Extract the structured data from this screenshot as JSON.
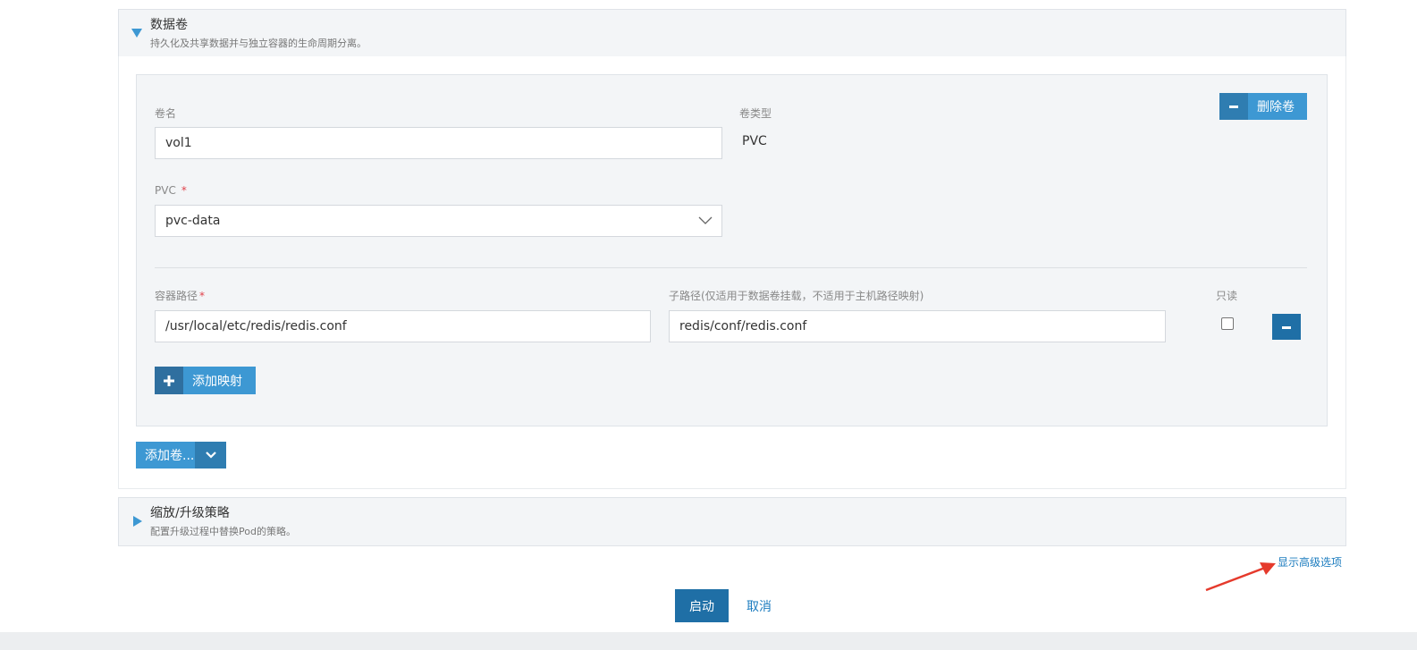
{
  "volumes_section": {
    "title": "数据卷",
    "subtitle": "持久化及共享数据并与独立容器的生命周期分离。"
  },
  "volume": {
    "name_label": "卷名",
    "name_value": "vol1",
    "type_label": "卷类型",
    "type_value": "PVC",
    "pvc_label": "PVC",
    "pvc_required": "*",
    "pvc_value": "pvc-data",
    "remove_button": "删除卷"
  },
  "mount": {
    "container_path_label": "容器路径",
    "container_path_required": "*",
    "container_path_value": "/usr/local/etc/redis/redis.conf",
    "sub_path_label": "子路径(仅适用于数据卷挂载，不适用于主机路径映射)",
    "sub_path_value": "redis/conf/redis.conf",
    "readonly_label": "只读",
    "add_mapping_button": "添加映射"
  },
  "add_volume_button": "添加卷...",
  "scaling_section": {
    "title": "缩放/升级策略",
    "subtitle": "配置升级过程中替换Pod的策略。"
  },
  "advanced_link": "显示高级选项",
  "actions": {
    "launch": "启动",
    "cancel": "取消"
  },
  "colors": {
    "primary": "#3d98d3",
    "primary_dark": "#1f6fa6",
    "annotation_arrow": "#e53a2c"
  }
}
